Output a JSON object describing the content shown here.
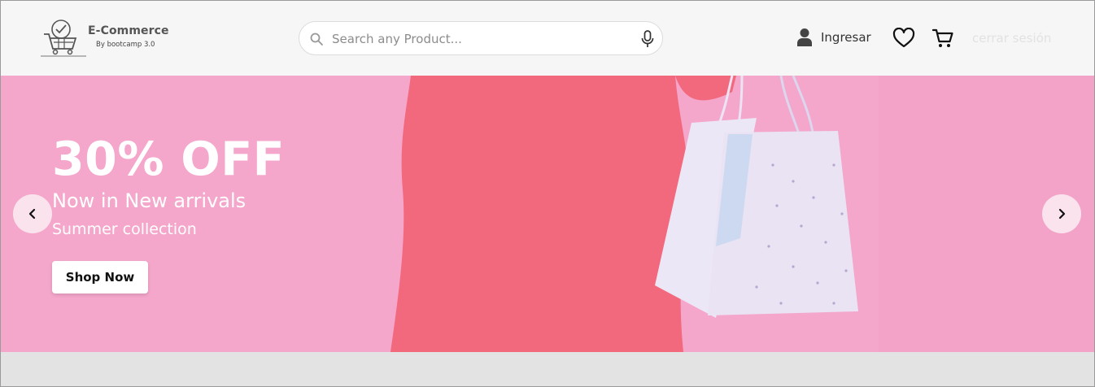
{
  "header": {
    "brand": {
      "title": "E-Commerce",
      "subtitle": "By bootcamp 3.0",
      "icon": "cart-check-logo-icon"
    },
    "search": {
      "placeholder": "Search any Product...",
      "value": "",
      "icon": "search-icon",
      "voice_icon": "microphone-icon"
    },
    "user": {
      "label": "Ingresar",
      "icon": "user-icon"
    },
    "wishlist_icon": "heart-icon",
    "cart_icon": "cart-icon",
    "logout_label": "cerrar sesión"
  },
  "hero": {
    "title": "30% OFF",
    "line1": "Now in New arrivals",
    "line2": "Summer collection",
    "button_label": "Shop Now",
    "background_color": "#f4a6cb",
    "prev_icon": "chevron-left-icon",
    "next_icon": "chevron-right-icon"
  },
  "colors": {
    "header_bg": "#f6f6f6",
    "accent_pink": "#f4a6cb",
    "sweater_red": "#f2687c",
    "page_bg": "#e3e3e3"
  }
}
